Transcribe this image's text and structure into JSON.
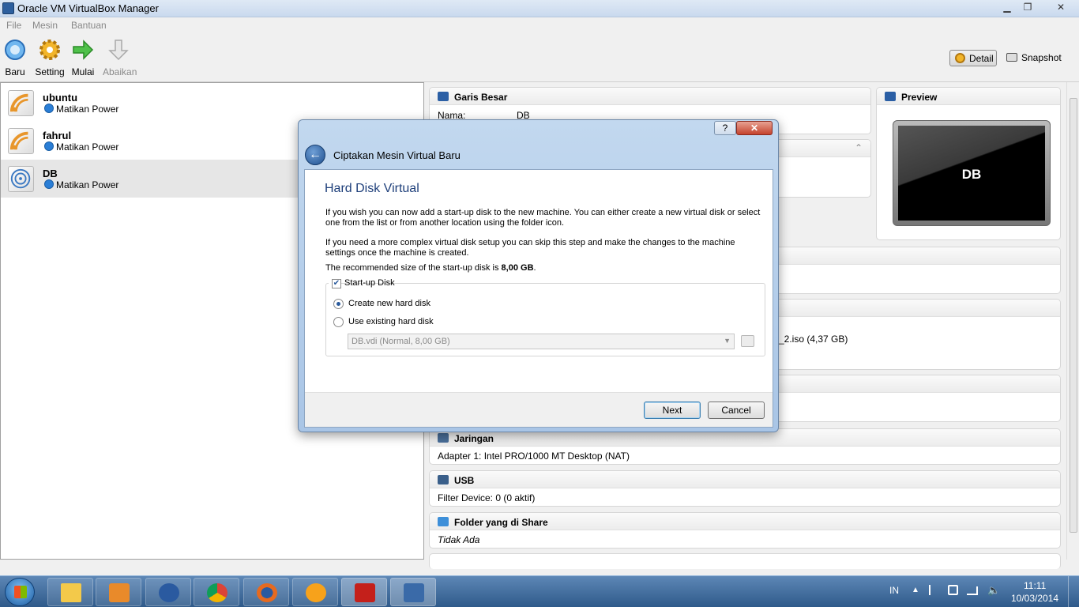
{
  "window": {
    "title": "Oracle VM VirtualBox Manager"
  },
  "menubar": {
    "items": [
      "File",
      "Mesin",
      "Bantuan"
    ]
  },
  "toolbar": {
    "buttons": [
      {
        "label": "Baru",
        "icon": "new-vm-icon"
      },
      {
        "label": "Setting",
        "icon": "gear-icon"
      },
      {
        "label": "Mulai",
        "icon": "start-arrow-icon"
      },
      {
        "label": "Abaikan",
        "icon": "discard-arrow-icon"
      }
    ],
    "detail_label": "Detail",
    "snapshot_label": "Snapshot"
  },
  "vm_list": [
    {
      "name": "ubuntu",
      "state": "Matikan Power"
    },
    {
      "name": "fahrul",
      "state": "Matikan Power"
    },
    {
      "name": "DB",
      "state": "Matikan Power"
    }
  ],
  "details": {
    "general": {
      "title": "Garis Besar",
      "name_label": "Nama:",
      "name_value": "DB"
    },
    "preview": {
      "title": "Preview",
      "vm_name": "DB"
    },
    "storage_partial": "_2.iso (4,37 GB)",
    "network": {
      "title": "Jaringan",
      "value": "Adapter 1: Intel PRO/1000 MT Desktop (NAT)"
    },
    "usb": {
      "title": "USB",
      "value": "Filter Device: 0 (0 aktif)"
    },
    "shared": {
      "title": "Folder yang di Share",
      "value": "Tidak Ada"
    }
  },
  "dialog": {
    "window_title": "Ciptakan Mesin Virtual Baru",
    "heading": "Hard Disk Virtual",
    "para1": "If you wish you can now add a start-up disk to the new machine. You can either create a new virtual disk or select one from the list or from another location using the folder icon.",
    "para2": "If you need a more complex virtual disk setup you can skip this step and make the changes to the machine settings once the machine is created.",
    "para3_prefix": "The recommended size of the start-up disk is ",
    "para3_size": "8,00 GB",
    "para3_suffix": ".",
    "startup_label": "Start-up Disk",
    "startup_checked": true,
    "option_create": "Create new hard disk",
    "option_existing": "Use existing hard disk",
    "selected_option": "create",
    "disk_select_value": "DB.vdi (Normal, 8,00 GB)",
    "next_label": "Next",
    "cancel_label": "Cancel",
    "help_symbol": "?",
    "close_symbol": "✕"
  },
  "taskbar": {
    "apps": [
      "explorer-icon",
      "media-player-icon",
      "app-icon",
      "chrome-icon",
      "firefox-icon",
      "vlc-icon",
      "acrobat-icon",
      "virtualbox-icon"
    ],
    "lang": "IN",
    "time": "11:11",
    "date": "10/03/2014"
  }
}
